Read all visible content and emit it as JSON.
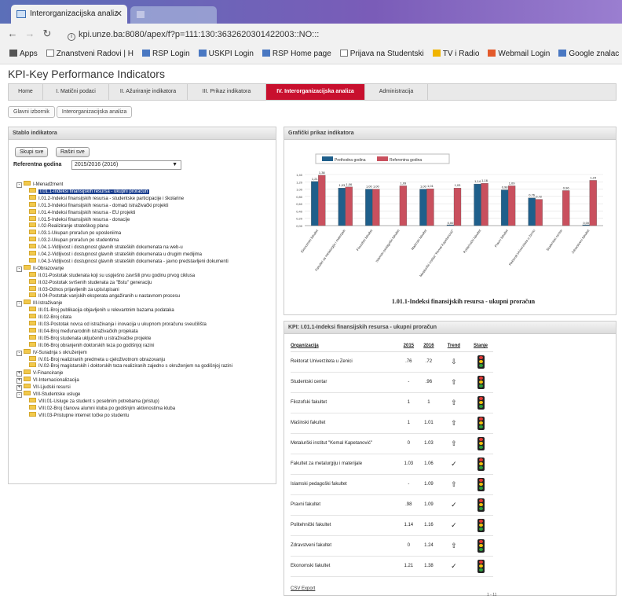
{
  "browser": {
    "tab_title": "Interorganizacijska analiz",
    "url": "kpi.unze.ba:8080/apex/f?p=111:130:3632620301422003::NO:::",
    "bookmarks": [
      "Apps",
      "Znanstveni Radovi | H",
      "RSP Login",
      "USKPI Login",
      "RSP Home page",
      "Prijava na Studentski",
      "TV i Radio",
      "Webmail Login",
      "Google znalac"
    ]
  },
  "app": {
    "title": "KPI-Key Performance Indicators"
  },
  "menu": [
    "Home",
    "I. Matični podaci",
    "II. Ažuriranje indikatora",
    "III. Prikaz indikatora",
    "IV. Interorganizacijska analiza",
    "Administracija"
  ],
  "breadcrumb": [
    "Glavni izbornik",
    "Interorganizacijska analiza"
  ],
  "left_panel": {
    "title": "Stablo indikatora",
    "collapse_label": "Skupi sve",
    "expand_label": "Raširi sve",
    "ref_label": "Referentna godina",
    "ref_value": "2015/2016 (2016)",
    "tree": [
      {
        "t": "I-Menadžment",
        "d": 0,
        "tog": "-"
      },
      {
        "t": "I.01.1-Indeksi finansijskih resursa - ukupni proračun",
        "d": 1,
        "sel": true
      },
      {
        "t": "I.01.2-Indeksi finansijskih resursa - studentske participacije i školarine",
        "d": 1
      },
      {
        "t": "I.01.3-Indeksi finansijskih resursa - domaći istraživački projekti",
        "d": 1
      },
      {
        "t": "I.01.4-Indeksi finansijskih resursa - EU projekti",
        "d": 1
      },
      {
        "t": "I.01.5-Indeksi finansijskih resursa - donacije",
        "d": 1
      },
      {
        "t": "I.02-Realiziranje strateškog plana",
        "d": 1
      },
      {
        "t": "I.03.1-Ukupan proračun po uposleniima",
        "d": 1
      },
      {
        "t": "I.03.2-Ukupan proračun po studentima",
        "d": 1
      },
      {
        "t": "I.04.1-Vidljivost i dostupnost glavnih strateških dokumenata na web-u",
        "d": 1
      },
      {
        "t": "I.04.2-Vidljivost i dostupnost glavnih strateških dokumenata u drugim medijima",
        "d": 1
      },
      {
        "t": "I.04.3-Vidljivost i dostupnost glavnih strateških dokumenata - javno predstavljeni dokumenti",
        "d": 1
      },
      {
        "t": "II-Obrazovanje",
        "d": 0,
        "tog": "-"
      },
      {
        "t": "II.01-Postotak studenata koji su uspješno završili prvu godinu prvog ciklusa",
        "d": 1
      },
      {
        "t": "II.02-Postotak svršenih studenata za \"Bstu\" generaciju",
        "d": 1
      },
      {
        "t": "II.03-Odnos prijavljenih za upis/upisani",
        "d": 1
      },
      {
        "t": "II.04-Postotak vanjskih eksperata angažiranih u nastavnom procesu",
        "d": 1
      },
      {
        "t": "III-Istraživanje",
        "d": 0,
        "tog": "-"
      },
      {
        "t": "III.01-Broj publikacija objavljenih u relevantnim bazama podataka",
        "d": 1
      },
      {
        "t": "III.02-Broj citata",
        "d": 1
      },
      {
        "t": "III.03-Postotak novca od istraživanja i inovacija u ukupnom proračunu sveučilišta",
        "d": 1
      },
      {
        "t": "III.04-Broj međunarodnih istraživačkih projekata",
        "d": 1
      },
      {
        "t": "III.05-Broj studenata uključenih u istraživačke projekte",
        "d": 1
      },
      {
        "t": "III.06-Broj obranjenih doktorskih teza po godišnjoj razini",
        "d": 1
      },
      {
        "t": "IV-Suradnja s okruženjem",
        "d": 0,
        "tog": "-"
      },
      {
        "t": "IV.01-Broj realiziranih predmeta u cjeloživotnom obrazovanju",
        "d": 1
      },
      {
        "t": "IV.02-Broj magistarskih i doktorskih teza realiziranih zajedno s okruženjem na godišnjoj razini",
        "d": 1
      },
      {
        "t": "V-Financiranje",
        "d": 0,
        "tog": "+"
      },
      {
        "t": "VI-Internacionalizacija",
        "d": 0,
        "tog": "+"
      },
      {
        "t": "VII-Ljudski resursi",
        "d": 0,
        "tog": "+"
      },
      {
        "t": "VIII-Studentske usluge",
        "d": 0,
        "tog": "-"
      },
      {
        "t": "VIII.01-Usluge za student s posebnim potrebama (pristup)",
        "d": 1
      },
      {
        "t": "VIII.02-Broj članova alumni kluba po godišnjim aktivnostima kluba",
        "d": 1
      },
      {
        "t": "VIII.03-Pristupne internet točke po studentu",
        "d": 1
      }
    ]
  },
  "chart_panel": {
    "title": "Grafički prikaz indikatora"
  },
  "chart_data": {
    "type": "bar",
    "title": "1.01.1-Indeksi finansijskih resursa - ukupni proračun",
    "legend": [
      "Prethodna godina",
      "Referentna godina"
    ],
    "legend_position": "top",
    "ylim": [
      0,
      1.4
    ],
    "yticks": [
      "1,40",
      "1,20",
      "1,00",
      "0,80",
      "0,60",
      "0,40",
      "0,20",
      "0,00"
    ],
    "categories": [
      "Ekonomski fakultet",
      "Fakultet za metalurgiju i materijale",
      "Filozofski fakultet",
      "Islamski pedagoški fakultet",
      "Mašinski fakultet",
      "Metalurški institut \"Kemal Kapetanović\"",
      "Politehnički fakultet",
      "Pravni fakultet",
      "Rektorat Univerziteta u Zenici",
      "Studentski centar",
      "Zdravstveni fakultet"
    ],
    "series": [
      {
        "name": "Prethodna godina",
        "color": "#1f5f8b",
        "values": [
          1.21,
          1.03,
          1.0,
          null,
          1.0,
          0.0,
          1.14,
          0.98,
          0.76,
          null,
          0.0
        ],
        "labels": [
          "1,21",
          "1,03",
          "1,00",
          "",
          "1,00",
          "0,00",
          "1,14",
          "0,98",
          "0,76",
          "",
          "0,00"
        ]
      },
      {
        "name": "Referentna godina",
        "color": "#c9505e",
        "values": [
          1.38,
          1.06,
          1.0,
          1.09,
          1.01,
          1.03,
          1.16,
          1.09,
          0.72,
          0.96,
          1.24
        ],
        "labels": [
          "1,38",
          "1,06",
          "1,00",
          "1,09",
          "1,01",
          "1,03",
          "1,16",
          "1,09",
          "0,72",
          "0,96",
          "1,24"
        ]
      }
    ]
  },
  "table_panel": {
    "title": "KPI: I.01.1-Indeksi finansijskih resursa - ukupni proračun",
    "headers": [
      "Organizacija",
      "2015",
      "2016",
      "Trend",
      "Stanje"
    ],
    "rows": [
      {
        "org": "Rektorat Univerziteta u Zenici",
        "y2015": ".76",
        "y2016": ".72",
        "trend": "⇩"
      },
      {
        "org": "Studentski centar",
        "y2015": "-",
        "y2016": ".96",
        "trend": "⇧"
      },
      {
        "org": "Filozofski fakultet",
        "y2015": "1",
        "y2016": "1",
        "trend": "⇧"
      },
      {
        "org": "Mašinski fakultet",
        "y2015": "1",
        "y2016": "1.01",
        "trend": "⇧"
      },
      {
        "org": "Metalurški institut \"Kemal Kapetanović\"",
        "y2015": "0",
        "y2016": "1.03",
        "trend": "⇧"
      },
      {
        "org": "Fakultet za metalurgiju i materijale",
        "y2015": "1.03",
        "y2016": "1.06",
        "trend": "✓"
      },
      {
        "org": "Islamski pedagoški fakultet",
        "y2015": "-",
        "y2016": "1.09",
        "trend": "⇧"
      },
      {
        "org": "Pravni fakultet",
        "y2015": ".98",
        "y2016": "1.09",
        "trend": "✓"
      },
      {
        "org": "Politehnički fakultet",
        "y2015": "1.14",
        "y2016": "1.16",
        "trend": "✓"
      },
      {
        "org": "Zdravstveni fakultet",
        "y2015": "0",
        "y2016": "1.24",
        "trend": "⇧"
      },
      {
        "org": "Ekonomski fakultet",
        "y2015": "1.21",
        "y2016": "1.38",
        "trend": "✓"
      }
    ],
    "csv_label": "CSV Export",
    "pager": "1 - 11"
  }
}
